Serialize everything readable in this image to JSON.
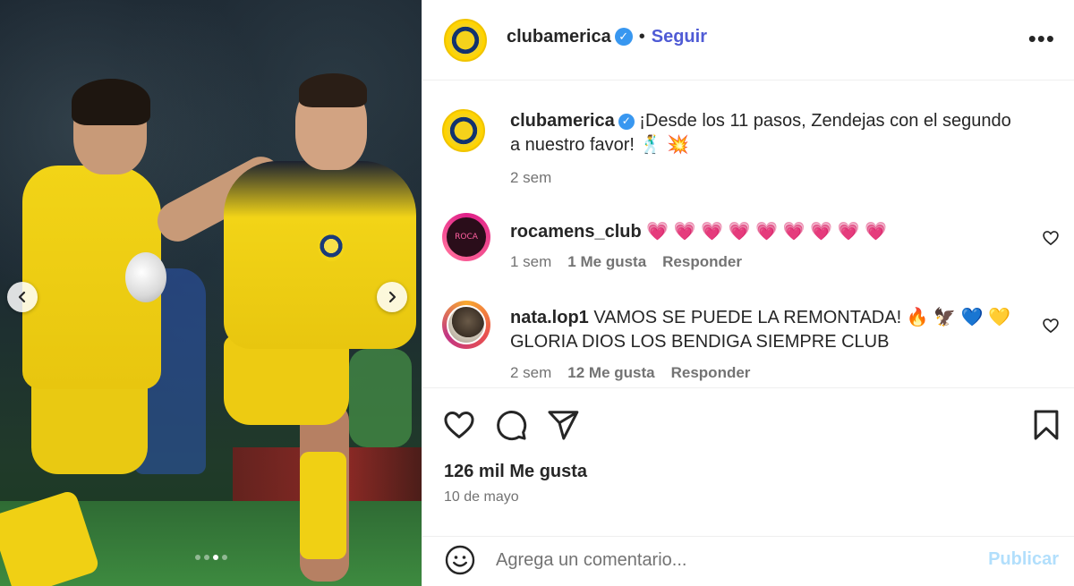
{
  "post": {
    "username": "clubamerica",
    "separator": "•",
    "follow_label": "Seguir",
    "more_label": "•••",
    "caption": "¡Desde los 11 pasos, Zendejas con el segundo a nuestro favor! 🕺 💥",
    "caption_time": "2 sem",
    "likes": "126 mil Me gusta",
    "date": "10 de mayo"
  },
  "comments": [
    {
      "username": "rocamens_club",
      "text": "💗 💗 💗 💗 💗 💗 💗 💗 💗",
      "avatar_text": "ROCA",
      "time": "1 sem",
      "likes": "1 Me gusta",
      "reply_label": "Responder"
    },
    {
      "username": "nata.lop1",
      "text": "VAMOS SE PUEDE LA REMONTADA! 🔥 🦅 💙 💛 GLORIA DIOS LOS BENDIGA SIEMPRE CLUB",
      "time": "2 sem",
      "likes": "12 Me gusta",
      "reply_label": "Responder"
    }
  ],
  "composer": {
    "placeholder": "Agrega un comentario...",
    "publish_label": "Publicar"
  },
  "carousel": {
    "slide_count": 4,
    "active_index": 2
  },
  "icons": {
    "like": "heart-icon",
    "comment": "comment-bubble-icon",
    "share": "send-icon",
    "save": "bookmark-icon",
    "emoji": "emoji-icon",
    "prev": "chevron-left-icon",
    "next": "chevron-right-icon",
    "verified": "verified-badge-icon"
  },
  "colors": {
    "follow": "#4f5bd5",
    "verified": "#3897f0",
    "publish_disabled": "#b2dffc",
    "secondary_text": "#737373"
  }
}
